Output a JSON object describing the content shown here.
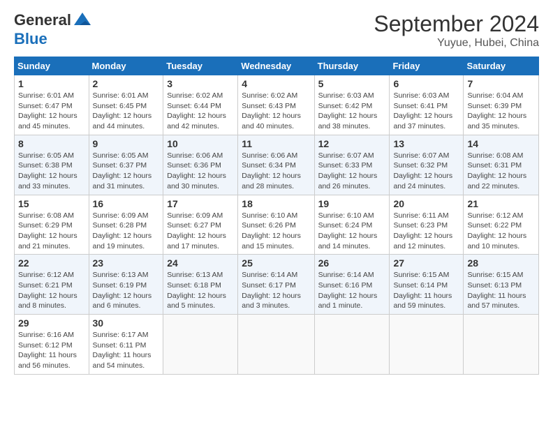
{
  "header": {
    "logo_line1": "General",
    "logo_line2": "Blue",
    "month": "September 2024",
    "location": "Yuyue, Hubei, China"
  },
  "weekdays": [
    "Sunday",
    "Monday",
    "Tuesday",
    "Wednesday",
    "Thursday",
    "Friday",
    "Saturday"
  ],
  "weeks": [
    [
      {
        "day": "1",
        "sunrise": "6:01 AM",
        "sunset": "6:47 PM",
        "daylight": "12 hours and 45 minutes."
      },
      {
        "day": "2",
        "sunrise": "6:01 AM",
        "sunset": "6:45 PM",
        "daylight": "12 hours and 44 minutes."
      },
      {
        "day": "3",
        "sunrise": "6:02 AM",
        "sunset": "6:44 PM",
        "daylight": "12 hours and 42 minutes."
      },
      {
        "day": "4",
        "sunrise": "6:02 AM",
        "sunset": "6:43 PM",
        "daylight": "12 hours and 40 minutes."
      },
      {
        "day": "5",
        "sunrise": "6:03 AM",
        "sunset": "6:42 PM",
        "daylight": "12 hours and 38 minutes."
      },
      {
        "day": "6",
        "sunrise": "6:03 AM",
        "sunset": "6:41 PM",
        "daylight": "12 hours and 37 minutes."
      },
      {
        "day": "7",
        "sunrise": "6:04 AM",
        "sunset": "6:39 PM",
        "daylight": "12 hours and 35 minutes."
      }
    ],
    [
      {
        "day": "8",
        "sunrise": "6:05 AM",
        "sunset": "6:38 PM",
        "daylight": "12 hours and 33 minutes."
      },
      {
        "day": "9",
        "sunrise": "6:05 AM",
        "sunset": "6:37 PM",
        "daylight": "12 hours and 31 minutes."
      },
      {
        "day": "10",
        "sunrise": "6:06 AM",
        "sunset": "6:36 PM",
        "daylight": "12 hours and 30 minutes."
      },
      {
        "day": "11",
        "sunrise": "6:06 AM",
        "sunset": "6:34 PM",
        "daylight": "12 hours and 28 minutes."
      },
      {
        "day": "12",
        "sunrise": "6:07 AM",
        "sunset": "6:33 PM",
        "daylight": "12 hours and 26 minutes."
      },
      {
        "day": "13",
        "sunrise": "6:07 AM",
        "sunset": "6:32 PM",
        "daylight": "12 hours and 24 minutes."
      },
      {
        "day": "14",
        "sunrise": "6:08 AM",
        "sunset": "6:31 PM",
        "daylight": "12 hours and 22 minutes."
      }
    ],
    [
      {
        "day": "15",
        "sunrise": "6:08 AM",
        "sunset": "6:29 PM",
        "daylight": "12 hours and 21 minutes."
      },
      {
        "day": "16",
        "sunrise": "6:09 AM",
        "sunset": "6:28 PM",
        "daylight": "12 hours and 19 minutes."
      },
      {
        "day": "17",
        "sunrise": "6:09 AM",
        "sunset": "6:27 PM",
        "daylight": "12 hours and 17 minutes."
      },
      {
        "day": "18",
        "sunrise": "6:10 AM",
        "sunset": "6:26 PM",
        "daylight": "12 hours and 15 minutes."
      },
      {
        "day": "19",
        "sunrise": "6:10 AM",
        "sunset": "6:24 PM",
        "daylight": "12 hours and 14 minutes."
      },
      {
        "day": "20",
        "sunrise": "6:11 AM",
        "sunset": "6:23 PM",
        "daylight": "12 hours and 12 minutes."
      },
      {
        "day": "21",
        "sunrise": "6:12 AM",
        "sunset": "6:22 PM",
        "daylight": "12 hours and 10 minutes."
      }
    ],
    [
      {
        "day": "22",
        "sunrise": "6:12 AM",
        "sunset": "6:21 PM",
        "daylight": "12 hours and 8 minutes."
      },
      {
        "day": "23",
        "sunrise": "6:13 AM",
        "sunset": "6:19 PM",
        "daylight": "12 hours and 6 minutes."
      },
      {
        "day": "24",
        "sunrise": "6:13 AM",
        "sunset": "6:18 PM",
        "daylight": "12 hours and 5 minutes."
      },
      {
        "day": "25",
        "sunrise": "6:14 AM",
        "sunset": "6:17 PM",
        "daylight": "12 hours and 3 minutes."
      },
      {
        "day": "26",
        "sunrise": "6:14 AM",
        "sunset": "6:16 PM",
        "daylight": "12 hours and 1 minute."
      },
      {
        "day": "27",
        "sunrise": "6:15 AM",
        "sunset": "6:14 PM",
        "daylight": "11 hours and 59 minutes."
      },
      {
        "day": "28",
        "sunrise": "6:15 AM",
        "sunset": "6:13 PM",
        "daylight": "11 hours and 57 minutes."
      }
    ],
    [
      {
        "day": "29",
        "sunrise": "6:16 AM",
        "sunset": "6:12 PM",
        "daylight": "11 hours and 56 minutes."
      },
      {
        "day": "30",
        "sunrise": "6:17 AM",
        "sunset": "6:11 PM",
        "daylight": "11 hours and 54 minutes."
      },
      null,
      null,
      null,
      null,
      null
    ]
  ]
}
